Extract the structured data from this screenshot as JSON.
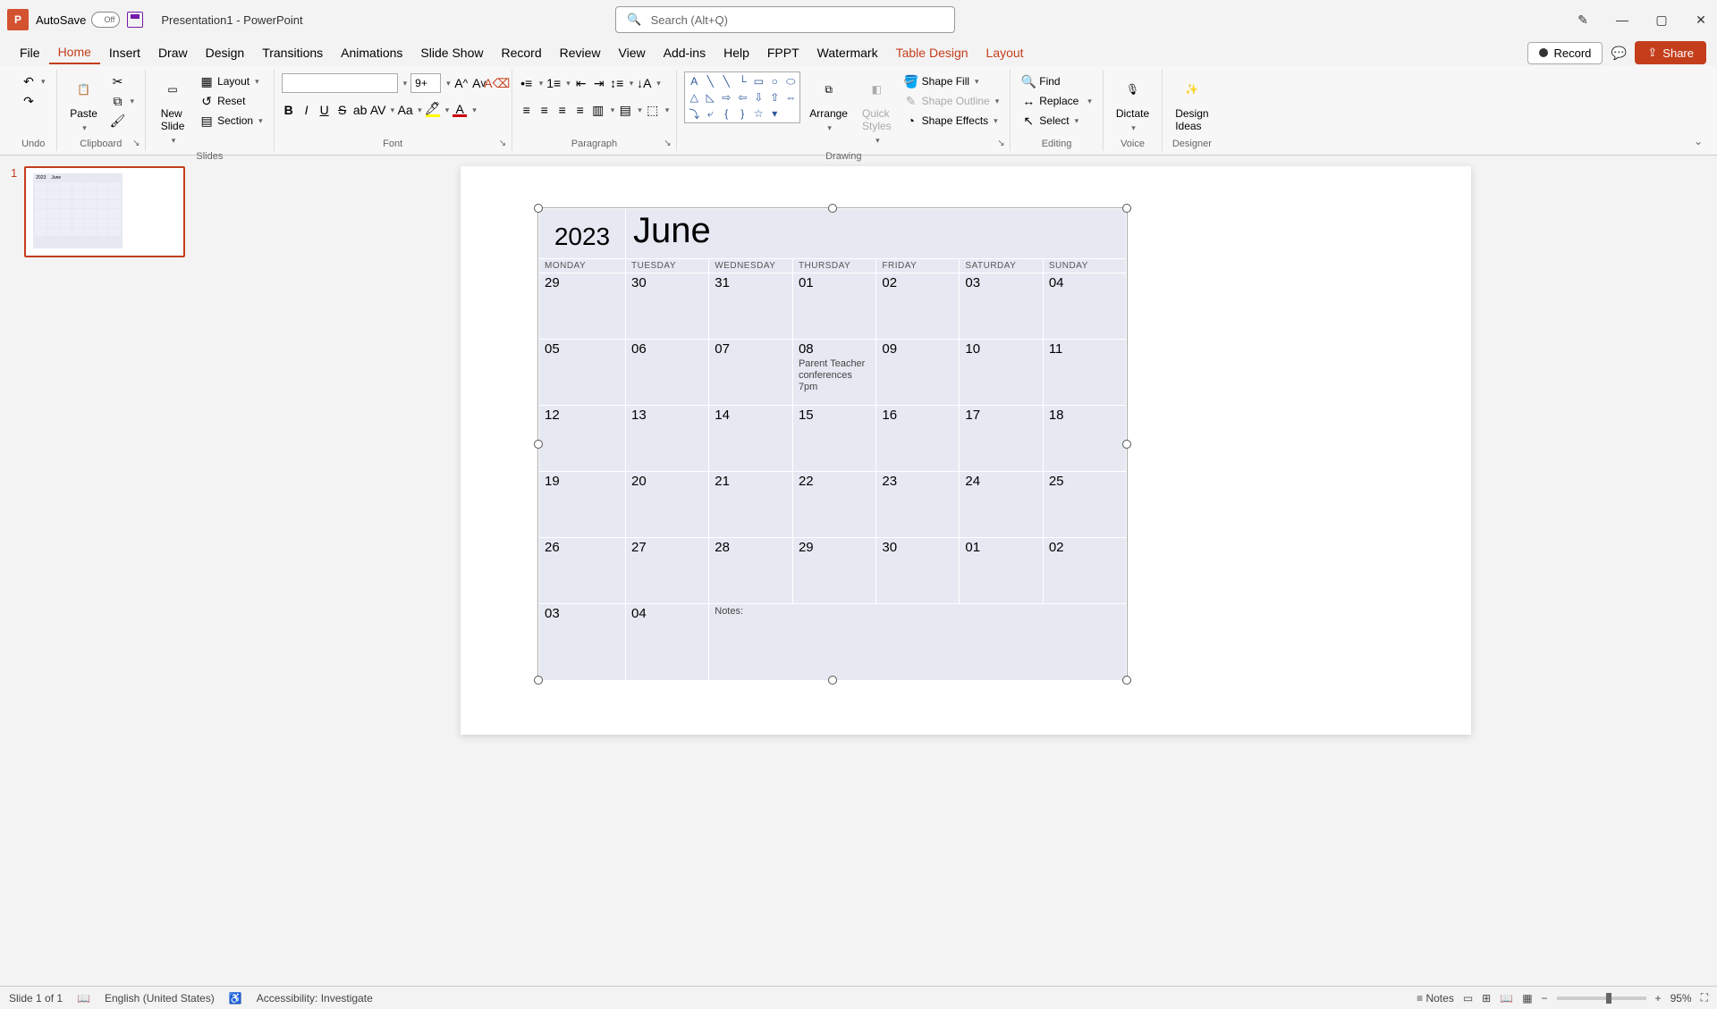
{
  "titlebar": {
    "autosave_label": "AutoSave",
    "autosave_state": "Off",
    "document_title": "Presentation1  -  PowerPoint",
    "search_placeholder": "Search (Alt+Q)"
  },
  "tabs": {
    "file": "File",
    "home": "Home",
    "insert": "Insert",
    "draw": "Draw",
    "design": "Design",
    "transitions": "Transitions",
    "animations": "Animations",
    "slideshow": "Slide Show",
    "record": "Record",
    "review": "Review",
    "view": "View",
    "addins": "Add-ins",
    "help": "Help",
    "fppt": "FPPT",
    "watermark": "Watermark",
    "tabledesign": "Table Design",
    "layout": "Layout"
  },
  "record_btn": "Record",
  "share_btn": "Share",
  "ribbon": {
    "undo_label": "Undo",
    "clipboard_label": "Clipboard",
    "paste": "Paste",
    "slides_label": "Slides",
    "new_slide": "New\nSlide",
    "layout": "Layout",
    "reset": "Reset",
    "section": "Section",
    "font_label": "Font",
    "font_name": "",
    "font_size": "9+",
    "paragraph_label": "Paragraph",
    "drawing_label": "Drawing",
    "arrange": "Arrange",
    "quick_styles": "Quick\nStyles",
    "shape_fill": "Shape Fill",
    "shape_outline": "Shape Outline",
    "shape_effects": "Shape Effects",
    "editing_label": "Editing",
    "find": "Find",
    "replace": "Replace",
    "select": "Select",
    "voice_label": "Voice",
    "dictate": "Dictate",
    "designer_label": "Designer",
    "design_ideas": "Design\nIdeas"
  },
  "slide_panel": {
    "slide1_num": "1"
  },
  "calendar": {
    "year": "2023",
    "month": "June",
    "dow": [
      "MONDAY",
      "TUESDAY",
      "WEDNESDAY",
      "THURSDAY",
      "FRIDAY",
      "SATURDAY",
      "SUNDAY"
    ],
    "weeks": [
      {
        "days": [
          "29",
          "30",
          "31",
          "01",
          "02",
          "03",
          "04"
        ],
        "events": [
          "",
          "",
          "",
          "",
          "",
          "",
          ""
        ]
      },
      {
        "days": [
          "05",
          "06",
          "07",
          "08",
          "09",
          "10",
          "11"
        ],
        "events": [
          "",
          "",
          "",
          "Parent Teacher conferences 7pm",
          "",
          "",
          ""
        ]
      },
      {
        "days": [
          "12",
          "13",
          "14",
          "15",
          "16",
          "17",
          "18"
        ],
        "events": [
          "",
          "",
          "",
          "",
          "",
          "",
          ""
        ]
      },
      {
        "days": [
          "19",
          "20",
          "21",
          "22",
          "23",
          "24",
          "25"
        ],
        "events": [
          "",
          "",
          "",
          "",
          "",
          "",
          ""
        ]
      },
      {
        "days": [
          "26",
          "27",
          "28",
          "29",
          "30",
          "01",
          "02"
        ],
        "events": [
          "",
          "",
          "",
          "",
          "",
          "",
          ""
        ]
      }
    ],
    "lastrow": {
      "days": [
        "03",
        "04"
      ],
      "notes_label": "Notes:"
    }
  },
  "statusbar": {
    "slide_info": "Slide 1 of 1",
    "language": "English (United States)",
    "accessibility": "Accessibility: Investigate",
    "notes": "Notes",
    "zoom": "95%"
  }
}
